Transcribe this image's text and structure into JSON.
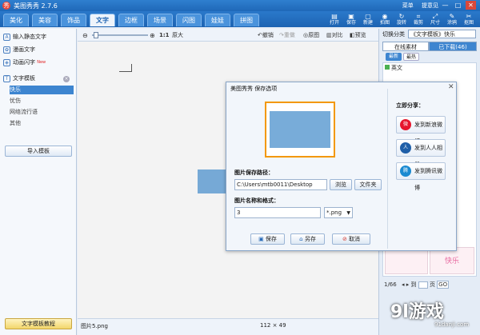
{
  "window": {
    "title": "美图秀秀 2.7.6",
    "links": [
      "菜单",
      "提意见"
    ],
    "controls": [
      "—",
      "□",
      "✕"
    ],
    "logo": "秀"
  },
  "nav_tabs": [
    "美化",
    "美容",
    "饰品",
    "文字",
    "边框",
    "场景",
    "闪图",
    "娃娃",
    "拼图"
  ],
  "active_tab": "文字",
  "toolbar": [
    {
      "icon": "folder-open-icon",
      "glyph": "▤",
      "label": "打开"
    },
    {
      "icon": "save-icon",
      "glyph": "▣",
      "label": "保存"
    },
    {
      "icon": "new-icon",
      "glyph": "▢",
      "label": "新建"
    },
    {
      "icon": "camera-icon",
      "glyph": "◉",
      "label": "拍图"
    },
    {
      "icon": "rotate-icon",
      "glyph": "↻",
      "label": "旋转"
    },
    {
      "icon": "crop-icon",
      "glyph": "⌗",
      "label": "裁剪"
    },
    {
      "icon": "resize-icon",
      "glyph": "⤢",
      "label": "尺寸"
    },
    {
      "icon": "brush-icon",
      "glyph": "✎",
      "label": "涂鸦"
    },
    {
      "icon": "capture-icon",
      "glyph": "✂",
      "label": "抠图"
    }
  ],
  "left_panel": {
    "items": [
      {
        "glyph": "A",
        "label": "输入静态文字"
      },
      {
        "glyph": "✿",
        "label": "漫画文字"
      },
      {
        "glyph": "◈",
        "label": "动画闪字",
        "badge": "New"
      }
    ],
    "section": "文字模板",
    "sub_items": [
      "快乐",
      "忧伤",
      "网络流行语",
      "其他"
    ],
    "selected_sub": "快乐",
    "import_button": "导入模板",
    "tutorial_button": "文字模板教程"
  },
  "canvas_bar": {
    "zoom": "1:1",
    "original_size": "原大",
    "undo": "撤销",
    "redo": "重做",
    "original": "原图",
    "compare": "对比",
    "preview": "预览"
  },
  "status_bar": {
    "filename": "图片5.png",
    "dimensions": "112 × 49"
  },
  "right_panel": {
    "title": "切换分类",
    "category": "《文字模板》快乐",
    "tabs": [
      "在线素材",
      "已下载(46)"
    ],
    "filters": [
      "最新",
      "最热"
    ],
    "item_label": "英文",
    "pager": "1/66",
    "goto_label": "到",
    "page_label": "页",
    "go": "GO",
    "sample_text": "快乐"
  },
  "dialog": {
    "title": "美图秀秀 保存选项",
    "close": "✕",
    "path_label": "图片保存路径：",
    "path_value": "C:\\Users\\mtb0011\\Desktop",
    "browse": "浏览",
    "folder": "文件夹",
    "name_label": "图片名称和格式：",
    "name_value": "3",
    "format_value": "*.png",
    "save": "保存",
    "save_as": "另存",
    "cancel": "取消",
    "share_title": "立即分享：",
    "share": [
      {
        "label": "发到新浪微博",
        "icon": "weibo-icon",
        "color": "#e6162d",
        "glyph": "微"
      },
      {
        "label": "发到人人相册",
        "icon": "renren-icon",
        "color": "#1f5fa8",
        "glyph": "人"
      },
      {
        "label": "发到腾讯微博",
        "icon": "tencent-weibo-icon",
        "color": "#1a8ad1",
        "glyph": "腾"
      }
    ]
  },
  "watermark": {
    "main": "9l游戏",
    "sub": "91danji.com"
  }
}
